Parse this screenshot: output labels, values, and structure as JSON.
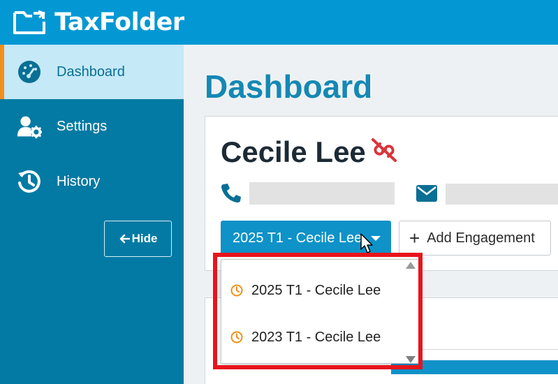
{
  "app": {
    "name": "TaxFolder"
  },
  "sidebar": {
    "items": [
      {
        "label": "Dashboard",
        "icon": "dashboard-gauge-icon",
        "active": true
      },
      {
        "label": "Settings",
        "icon": "user-gear-icon",
        "active": false
      },
      {
        "label": "History",
        "icon": "history-icon",
        "active": false
      }
    ],
    "hide_label": "Hide",
    "hide_icon": "arrow-left-icon"
  },
  "main": {
    "title": "Dashboard",
    "client": {
      "name": "Cecile Lee",
      "status_icon": "unlink-icon",
      "phone_icon": "phone-icon",
      "email_icon": "envelope-icon"
    },
    "engagement_select": {
      "selected": "2025 T1 - Cecile Lee",
      "icon": "caret-down-icon"
    },
    "add_engagement_label": "Add Engagement",
    "dropdown": {
      "options": [
        {
          "label": "2025 T1 - Cecile Lee",
          "icon": "clock-icon"
        },
        {
          "label": "2023 T1 - Cecile Lee",
          "icon": "clock-icon"
        }
      ]
    }
  },
  "colors": {
    "topbar": "#0398d4",
    "sidebar": "#037aa3",
    "sidebar_active": "#c5e9f7",
    "active_accent": "#f28f1c",
    "title": "#1488b4",
    "primary_button": "#0e92c8",
    "unlink": "#d9353b",
    "clock": "#f28f1c",
    "annotation_box": "#e8141c"
  }
}
